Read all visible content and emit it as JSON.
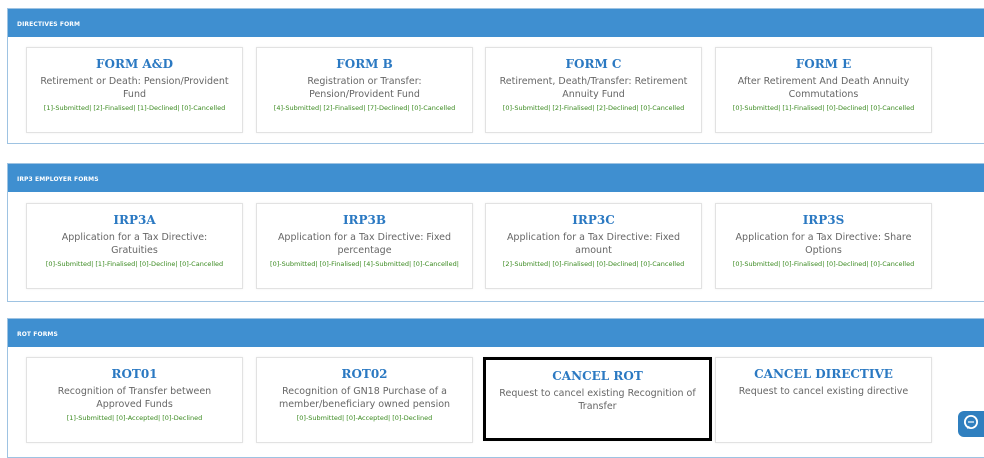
{
  "sections": [
    {
      "title": "DIRECTIVES FORM",
      "cards": [
        {
          "title": "FORM A&D",
          "desc": "Retirement or Death: Pension/Provident Fund",
          "status": "[1]-Submitted| [2]-Finalised| [1]-Declined| [0]-Cancelled"
        },
        {
          "title": "FORM B",
          "desc": "Registration or Transfer: Pension/Provident Fund",
          "status": "[4]-Submitted| [2]-Finalised| [7]-Declined| [0]-Cancelled"
        },
        {
          "title": "FORM C",
          "desc": "Retirement, Death/Transfer: Retirement Annuity Fund",
          "status": "[0]-Submitted| [2]-Finalised| [2]-Declined| [0]-Cancelled"
        },
        {
          "title": "FORM E",
          "desc": "After Retirement And Death Annuity Commutations",
          "status": "[0]-Submitted| [1]-Finalised| [0]-Declined| [0]-Cancelled"
        }
      ]
    },
    {
      "title": "IRP3 EMPLOYER FORMS",
      "cards": [
        {
          "title": "IRP3A",
          "desc": "Application for a Tax Directive: Gratuities",
          "status": "[0]-Submitted| [1]-Finalised| [0]-Decline| [0]-Cancelled"
        },
        {
          "title": "IRP3B",
          "desc": "Application for a Tax Directive: Fixed percentage",
          "status": "[0]-Submitted| [0]-Finalised| [4]-Submitted| [0]-Cancelled|"
        },
        {
          "title": "IRP3C",
          "desc": "Application for a Tax Directive: Fixed amount",
          "status": "[2]-Submitted| [0]-Finalised| [0]-Declined| [0]-Cancelled"
        },
        {
          "title": "IRP3S",
          "desc": "Application for a Tax Directive: Share Options",
          "status": "[0]-Submitted| [0]-Finalised| [0]-Declined| [0]-Cancelled"
        }
      ]
    },
    {
      "title": "ROT FORMS",
      "cards": [
        {
          "title": "ROT01",
          "desc": "Recognition of Transfer between Approved Funds",
          "status": "[1]-Submitted| [0]-Accepted| [0]-Declined"
        },
        {
          "title": "ROT02",
          "desc": "Recognition of GN18 Purchase of a member/beneficiary owned pension",
          "status": "[0]-Submitted| [0]-Accepted| [0]-Declined"
        },
        {
          "title": "CANCEL ROT",
          "desc": "Request to cancel existing Recognition of Transfer",
          "status": ""
        },
        {
          "title": "CANCEL DIRECTIVE",
          "desc": "Request to cancel existing directive",
          "status": ""
        }
      ]
    }
  ],
  "colors": {
    "header": "#3f8fd0",
    "card_title": "#2b79c2",
    "status": "#3a8a1f"
  },
  "chat_icon": "chat-icon"
}
